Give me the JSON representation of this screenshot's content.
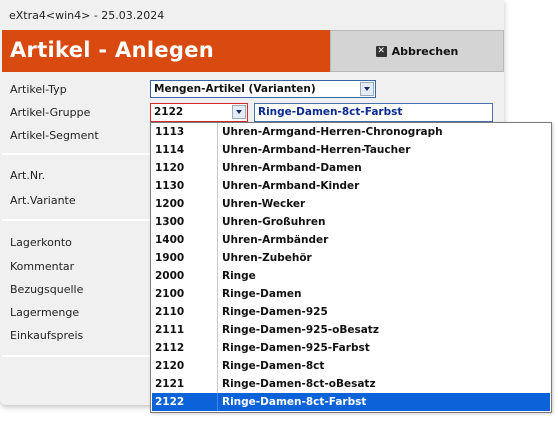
{
  "window": {
    "title": "eXtra4<win4>  -  25.03.2024"
  },
  "header": {
    "title": "Artikel - Anlegen",
    "cancel_label": "Abbrechen"
  },
  "form": {
    "labels": {
      "artikel_typ": "Artikel-Typ",
      "artikel_gruppe": "Artikel-Gruppe",
      "artikel_segment": "Artikel-Segment",
      "artnr": "Art.Nr.",
      "artvariante": "Art.Variante",
      "lagerkonto": "Lagerkonto",
      "kommentar": "Kommentar",
      "bezugsquelle": "Bezugsquelle",
      "lagermenge": "Lagermenge",
      "einkaufspreis": "Einkaufspreis"
    },
    "artikel_typ_value": "Mengen-Artikel (Varianten)",
    "artikel_gruppe_code": "2122",
    "artikel_gruppe_desc": "Ringe-Damen-8ct-Farbst"
  },
  "dropdown": {
    "items": [
      {
        "code": "1113",
        "name": "Uhren-Armgand-Herren-Chronograph"
      },
      {
        "code": "1114",
        "name": "Uhren-Armband-Herren-Taucher"
      },
      {
        "code": "1120",
        "name": "Uhren-Armband-Damen"
      },
      {
        "code": "1130",
        "name": "Uhren-Armband-Kinder"
      },
      {
        "code": "1200",
        "name": "Uhren-Wecker"
      },
      {
        "code": "1300",
        "name": "Uhren-Großuhren"
      },
      {
        "code": "1400",
        "name": "Uhren-Armbänder"
      },
      {
        "code": "1900",
        "name": "Uhren-Zubehör"
      },
      {
        "code": "2000",
        "name": "Ringe"
      },
      {
        "code": "2100",
        "name": "Ringe-Damen"
      },
      {
        "code": "2110",
        "name": "Ringe-Damen-925"
      },
      {
        "code": "2111",
        "name": "Ringe-Damen-925-oBesatz"
      },
      {
        "code": "2112",
        "name": "Ringe-Damen-925-Farbst"
      },
      {
        "code": "2120",
        "name": "Ringe-Damen-8ct"
      },
      {
        "code": "2121",
        "name": "Ringe-Damen-8ct-oBesatz"
      },
      {
        "code": "2122",
        "name": "Ringe-Damen-8ct-Farbst"
      }
    ],
    "selected_index": 15
  },
  "colors": {
    "header_bg": "#d94a10",
    "selection": "#0c62d8"
  }
}
